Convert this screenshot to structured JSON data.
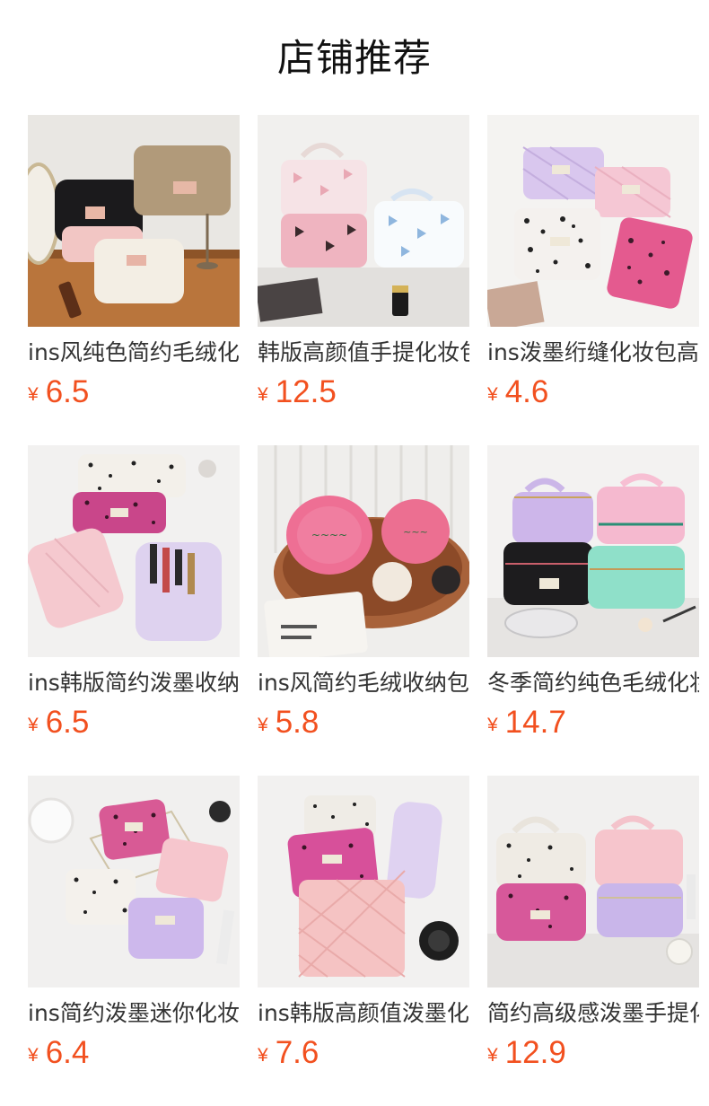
{
  "page_title": "店铺推荐",
  "currency_symbol": "¥",
  "products": [
    {
      "name": "ins风纯色简约毛绒化妆包",
      "price": "6.5",
      "image": "plush-cosmetic-bags"
    },
    {
      "name": "韩版高颜值手提化妆包",
      "price": "12.5",
      "image": "bow-print-handle-bags"
    },
    {
      "name": "ins泼墨绗缝化妆包高颜值",
      "price": "4.6",
      "image": "quilted-splash-pouches"
    },
    {
      "name": "ins韩版简约泼墨收纳包",
      "price": "6.5",
      "image": "splash-storage-bags"
    },
    {
      "name": "ins风简约毛绒收纳包",
      "price": "5.8",
      "image": "round-pink-pouches"
    },
    {
      "name": "冬季简约纯色毛绒化妆包",
      "price": "14.7",
      "image": "winter-plush-cases"
    },
    {
      "name": "ins简约泼墨迷你化妆包",
      "price": "6.4",
      "image": "mini-splash-pouches"
    },
    {
      "name": "ins韩版高颜值泼墨化妆包",
      "price": "7.6",
      "image": "quilted-pink-pouches"
    },
    {
      "name": "简约高级感泼墨手提化妆包",
      "price": "12.9",
      "image": "handle-splash-cases"
    }
  ]
}
